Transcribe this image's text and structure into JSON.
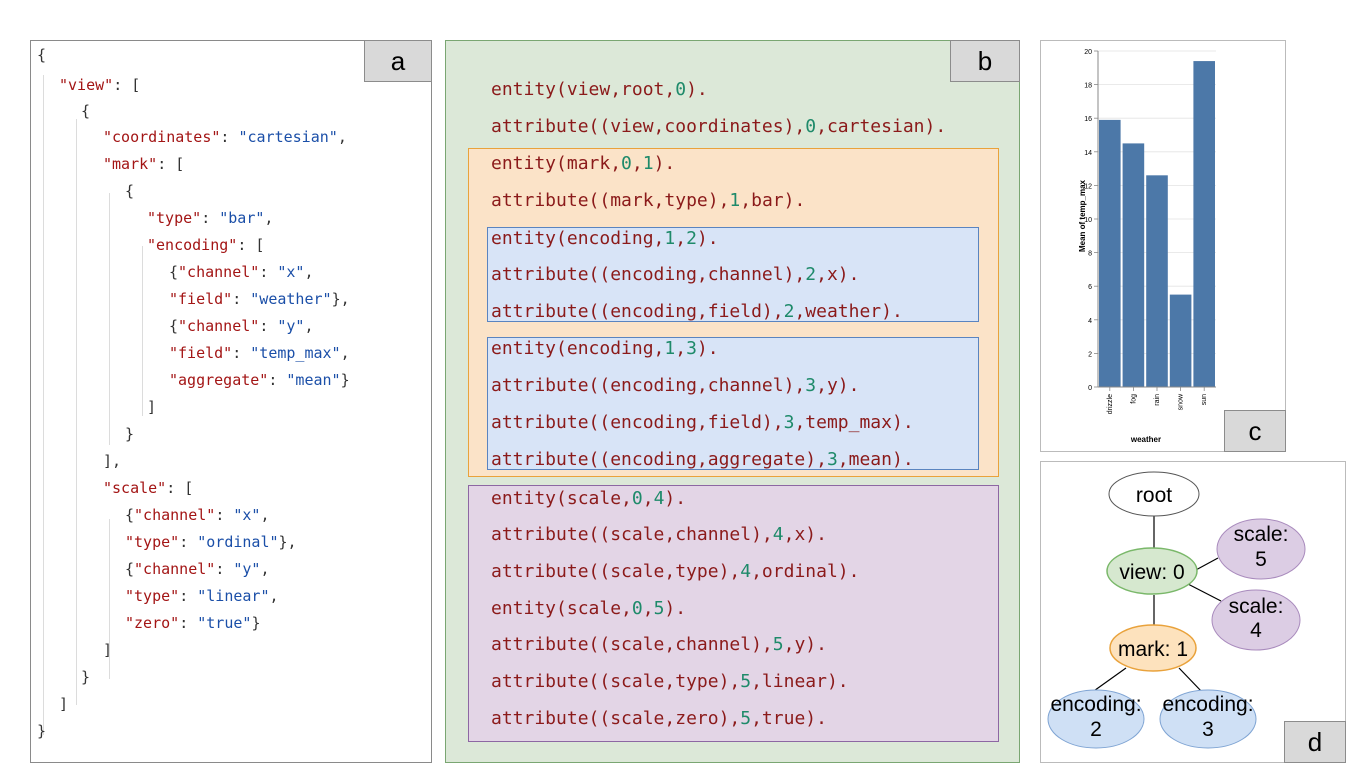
{
  "panel_a": {
    "label": "a",
    "lines": [
      [
        [
          "p",
          "{"
        ]
      ],
      [
        [
          "k",
          "\"view\""
        ],
        [
          "p",
          ": ["
        ]
      ],
      [
        [
          "p",
          "{"
        ]
      ],
      [
        [
          "k",
          "\"coordinates\""
        ],
        [
          "p",
          ": "
        ],
        [
          "s",
          "\"cartesian\""
        ],
        [
          "p",
          ","
        ]
      ],
      [
        [
          "k",
          "\"mark\""
        ],
        [
          "p",
          ": ["
        ]
      ],
      [
        [
          "p",
          "{"
        ]
      ],
      [
        [
          "k",
          "\"type\""
        ],
        [
          "p",
          ": "
        ],
        [
          "s",
          "\"bar\""
        ],
        [
          "p",
          ","
        ]
      ],
      [
        [
          "k",
          "\"encoding\""
        ],
        [
          "p",
          ": ["
        ]
      ],
      [
        [
          "p",
          "{"
        ],
        [
          "k",
          "\"channel\""
        ],
        [
          "p",
          ": "
        ],
        [
          "s",
          "\"x\""
        ],
        [
          "p",
          ","
        ]
      ],
      [
        [
          "k",
          "\"field\""
        ],
        [
          "p",
          ": "
        ],
        [
          "s",
          "\"weather\""
        ],
        [
          "p",
          "},"
        ]
      ],
      [
        [
          "p",
          "{"
        ],
        [
          "k",
          "\"channel\""
        ],
        [
          "p",
          ": "
        ],
        [
          "s",
          "\"y\""
        ],
        [
          "p",
          ","
        ]
      ],
      [
        [
          "k",
          "\"field\""
        ],
        [
          "p",
          ": "
        ],
        [
          "s",
          "\"temp_max\""
        ],
        [
          "p",
          ","
        ]
      ],
      [
        [
          "k",
          "\"aggregate\""
        ],
        [
          "p",
          ": "
        ],
        [
          "s",
          "\"mean\""
        ],
        [
          "p",
          "}"
        ]
      ],
      [
        [
          "p",
          "]"
        ]
      ],
      [
        [
          "p",
          "}"
        ]
      ],
      [
        [
          "p",
          "],"
        ]
      ],
      [
        [
          "k",
          "\"scale\""
        ],
        [
          "p",
          ": ["
        ]
      ],
      [
        [
          "p",
          "{"
        ],
        [
          "k",
          "\"channel\""
        ],
        [
          "p",
          ": "
        ],
        [
          "s",
          "\"x\""
        ],
        [
          "p",
          ","
        ]
      ],
      [
        [
          "k",
          "\"type\""
        ],
        [
          "p",
          ": "
        ],
        [
          "s",
          "\"ordinal\""
        ],
        [
          "p",
          "},"
        ]
      ],
      [
        [
          "p",
          "{"
        ],
        [
          "k",
          "\"channel\""
        ],
        [
          "p",
          ": "
        ],
        [
          "s",
          "\"y\""
        ],
        [
          "p",
          ","
        ]
      ],
      [
        [
          "k",
          "\"type\""
        ],
        [
          "p",
          ": "
        ],
        [
          "s",
          "\"linear\""
        ],
        [
          "p",
          ","
        ]
      ],
      [
        [
          "k",
          "\"zero\""
        ],
        [
          "p",
          ": "
        ],
        [
          "s",
          "\"true\""
        ],
        [
          "p",
          "}"
        ]
      ],
      [
        [
          "p",
          "]"
        ]
      ],
      [
        [
          "p",
          "}"
        ]
      ],
      [
        [
          "p",
          "]"
        ]
      ],
      [
        [
          "p",
          "}"
        ]
      ]
    ]
  },
  "panel_b": {
    "label": "b",
    "lines": [
      "entity(view,root,0).",
      "attribute((view,coordinates),0,cartesian).",
      "entity(mark,0,1).",
      "attribute((mark,type),1,bar).",
      "entity(encoding,1,2).",
      "attribute((encoding,channel),2,x).",
      "attribute((encoding,field),2,weather).",
      "entity(encoding,1,3).",
      "attribute((encoding,channel),3,y).",
      "attribute((encoding,field),3,temp_max).",
      "attribute((encoding,aggregate),3,mean).",
      "entity(scale,0,4).",
      "attribute((scale,channel),4,x).",
      "attribute((scale,type),4,ordinal).",
      "entity(scale,0,5).",
      "attribute((scale,channel),5,y).",
      "attribute((scale,type),5,linear).",
      "attribute((scale,zero),5,true)."
    ]
  },
  "panel_c": {
    "label": "c",
    "chart_data": {
      "type": "bar",
      "categories": [
        "drizzle",
        "fog",
        "rain",
        "snow",
        "sun"
      ],
      "values": [
        15.9,
        14.5,
        12.6,
        5.5,
        19.4
      ],
      "xlabel": "weather",
      "ylabel": "Mean of temp_max",
      "ylim": [
        0,
        20
      ],
      "yticks": [
        0,
        2,
        4,
        6,
        8,
        10,
        12,
        14,
        16,
        18,
        20
      ],
      "bar_color": "#4c78a8"
    }
  },
  "panel_d": {
    "label": "d",
    "nodes": {
      "root": [
        "root"
      ],
      "view": [
        "view: 0"
      ],
      "scale5": [
        "scale:",
        "5"
      ],
      "scale4": [
        "scale:",
        "4"
      ],
      "mark": [
        "mark: 1"
      ],
      "enc2": [
        "encoding:",
        "2"
      ],
      "enc3": [
        "encoding:",
        "3"
      ]
    },
    "colors": {
      "root": "#ffffff",
      "view": "#d6e8cf",
      "scale": "#dccde4",
      "mark": "#fde2bd",
      "encoding": "#cfe0f5"
    }
  }
}
